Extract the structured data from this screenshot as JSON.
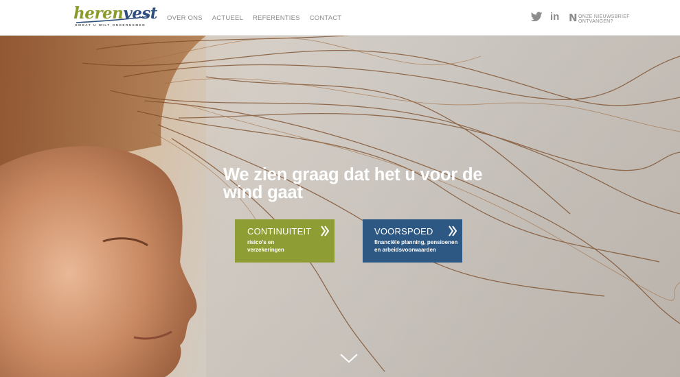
{
  "logo": {
    "part1": "heren",
    "part2": "vest",
    "tagline": "OMDAT U WILT ONDERNEMEN"
  },
  "nav": {
    "items": [
      "OVER ONS",
      "ACTUEEL",
      "REFERENTIES",
      "CONTACT"
    ]
  },
  "social": {
    "linkedin_label": "in",
    "newsletter_logo": "N",
    "newsletter_line1": "ONZE NIEUWSBRIEF",
    "newsletter_line2": "ONTVANGEN?"
  },
  "hero": {
    "headline": "We zien graag dat het u voor de wind gaat"
  },
  "cards": [
    {
      "title": "CONTINUITEIT",
      "sub1": "risico's en",
      "sub2": "verzekeringen",
      "color": "#8f9d35"
    },
    {
      "title": "VOORSPOED",
      "sub1": "financiële planning, pensioenen",
      "sub2": "en arbeidsvoorwaarden",
      "color": "#2d5883"
    }
  ],
  "icons": [
    "twitter-icon",
    "linkedin-icon",
    "newsletter-icon",
    "chevron-right-icon",
    "chevron-down-icon"
  ]
}
